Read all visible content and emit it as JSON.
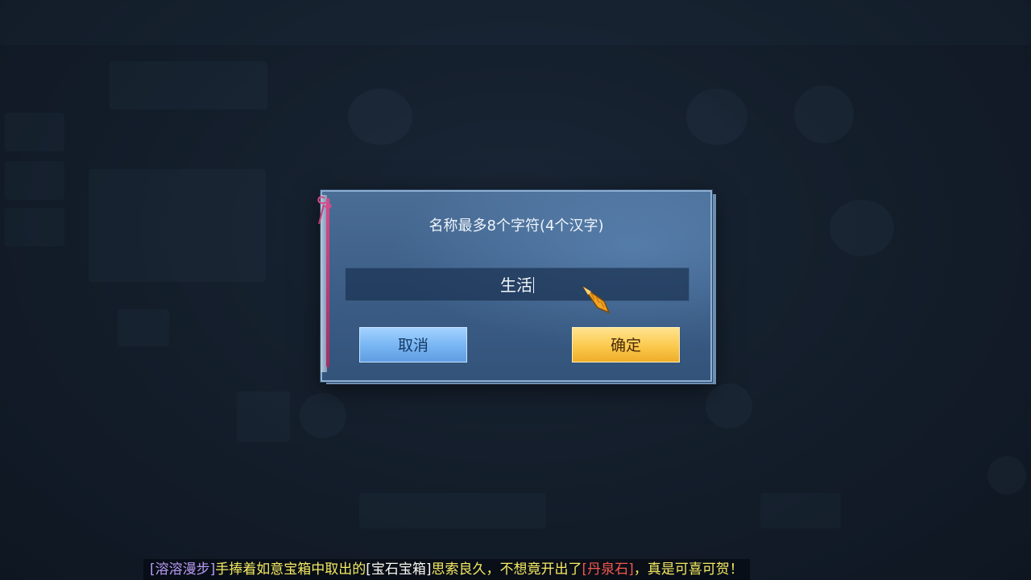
{
  "dialog": {
    "title": "名称最多8个字符(4个汉字)",
    "input_value": "生活",
    "cancel_label": "取消",
    "confirm_label": "确定"
  },
  "broadcast": {
    "player": "[溶溶漫步]",
    "text1": "手捧着如意宝箱中取出的",
    "item": "[宝石宝箱]",
    "text2": "思索良久，不想竟开出了",
    "reward": "[丹泉石]",
    "text3": "，真是可喜可贺！"
  },
  "colors": {
    "dialog_bg": "#3b5d86",
    "cancel_button": "#7ab7f4",
    "confirm_button": "#fbc94d",
    "player_name": "#b79af2",
    "reward_name": "#f2584f",
    "broadcast_text": "#f4ea62"
  },
  "icons": [
    "ribbon-bookmark-icon",
    "carrot-cursor-icon"
  ]
}
